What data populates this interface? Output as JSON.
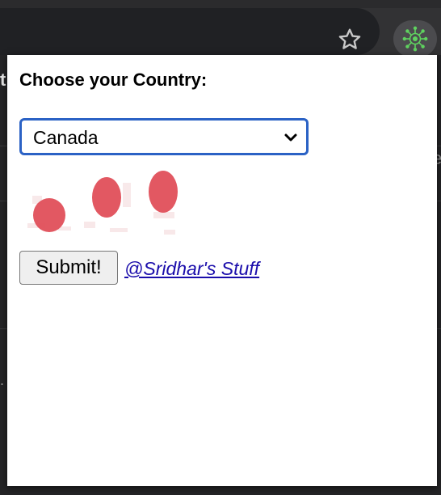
{
  "browser": {
    "bookmark_icon": "star-icon",
    "extension_icon": "virus-icon",
    "extension_color": "#5fd35f"
  },
  "background_page": {
    "left_glyph": "t",
    "right_glyph": "e",
    "dot_glyph": "."
  },
  "popup": {
    "heading": "Choose your Country:",
    "country_select": {
      "selected": "Canada"
    },
    "captcha": {
      "dot_color": "#e04a55",
      "dot_count": 3
    },
    "submit_label": "Submit!",
    "credit_link": "@Sridhar's Stuff"
  }
}
